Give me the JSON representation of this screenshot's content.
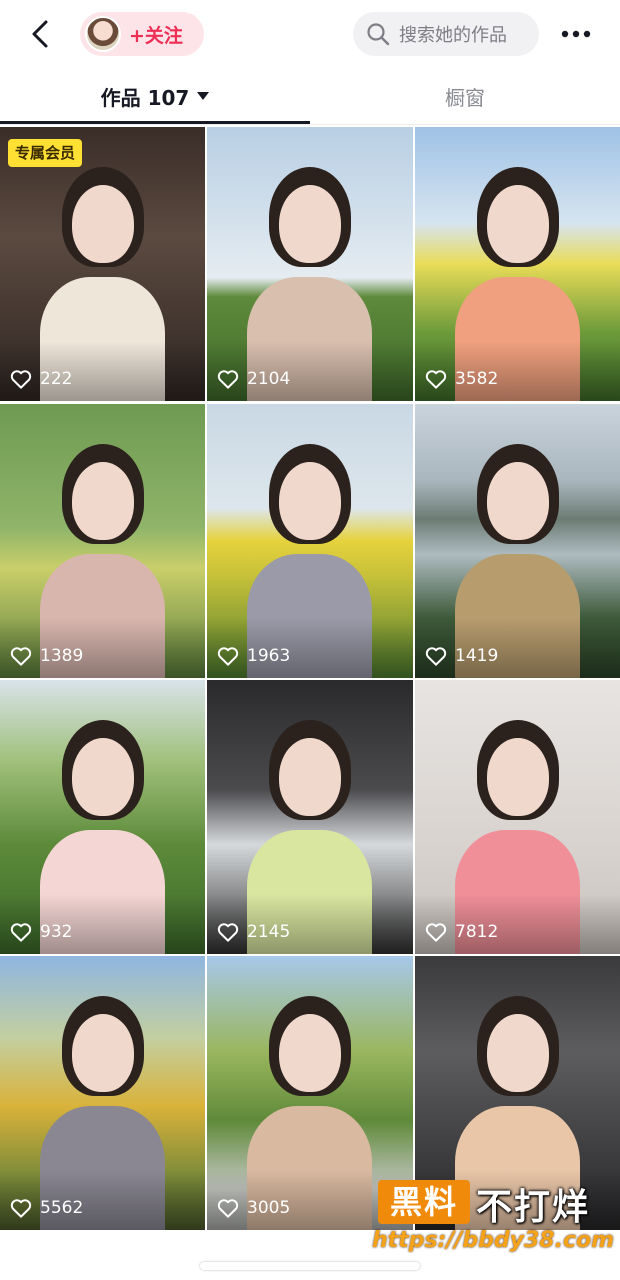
{
  "header": {
    "back_icon": "chevron-left-icon",
    "follow_label": "+关注",
    "search_placeholder": "搜索她的作品",
    "more_icon": "more-dots-icon"
  },
  "tabs": [
    {
      "label": "作品 107",
      "active": true
    },
    {
      "label": "橱窗",
      "active": false
    }
  ],
  "grid": [
    {
      "likes": "222",
      "badge": "专属会员",
      "tone": "indoor-dark",
      "outfit": "#efe6da"
    },
    {
      "likes": "2104",
      "tone": "field-sky",
      "outfit": "#d9bfae"
    },
    {
      "likes": "3582",
      "tone": "yellow-flowers",
      "outfit": "#f0a07e"
    },
    {
      "likes": "1389",
      "tone": "green-garden",
      "outfit": "#d8b6ae"
    },
    {
      "likes": "1963",
      "tone": "rapeseed-field",
      "outfit": "#9a9aa8"
    },
    {
      "likes": "1419",
      "tone": "lake",
      "outfit": "#b79c6e"
    },
    {
      "likes": "932",
      "tone": "leaves-flowers",
      "outfit": "#f4d6d4"
    },
    {
      "likes": "2145",
      "tone": "car-interior",
      "outfit": "#d8e6a0"
    },
    {
      "likes": "7812",
      "tone": "white-wall",
      "outfit": "#f08f98"
    },
    {
      "likes": "5562",
      "tone": "autumn-trees",
      "outfit": "#8a8793"
    },
    {
      "likes": "3005",
      "tone": "park-trees",
      "outfit": "#d9b9a0"
    },
    {
      "likes": "",
      "tone": "car-interior-2",
      "outfit": "#e9c6a8"
    }
  ],
  "watermark": {
    "logo": "黑料",
    "slogan": "不打烊",
    "url": "https://bbdy38.com"
  },
  "colors": {
    "accent": "#ee2e55",
    "follow_bg": "#fde4e8",
    "badge_bg": "#ffe033"
  }
}
